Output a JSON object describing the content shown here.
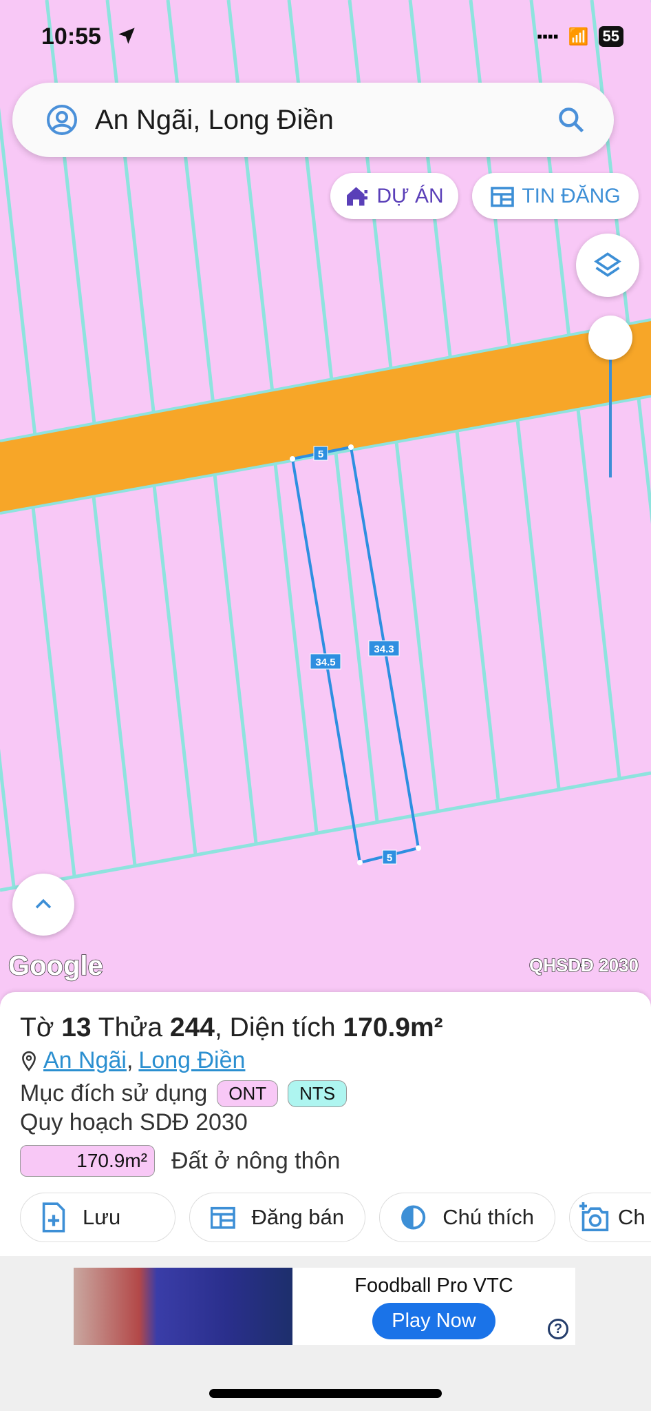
{
  "status_bar": {
    "time": "10:55",
    "battery": "55"
  },
  "search": {
    "value": "An Ngãi, Long Điền"
  },
  "chips": {
    "du_an": "DỰ ÁN",
    "tin_dang": "TIN ĐĂNG"
  },
  "map": {
    "parcel_edges": {
      "top": "5",
      "left": "34.5",
      "right": "34.3",
      "bottom": "5"
    },
    "google_logo": "Google",
    "layer_label": "QHSDĐ 2030",
    "colors": {
      "land": "#f8c8f6",
      "road": "#f7a628",
      "boundary": "#8ee3de",
      "parcel": "#2e8fe0"
    }
  },
  "sheet": {
    "title_prefix": "Tờ ",
    "sheet_no": "13",
    "title_mid": " Thửa ",
    "parcel_no": "244",
    "title_area_label": ", Diện tích ",
    "area": "170.9m²",
    "location": {
      "commune": "An Ngãi",
      "sep": ",",
      "district": "Long Điền"
    },
    "purpose_label": "Mục đích sử dụng",
    "tags": [
      {
        "code": "ONT",
        "color": "#f8c8f6"
      },
      {
        "code": "NTS",
        "color": "#aef5f0"
      }
    ],
    "plan_label": "Quy hoạch SDĐ 2030",
    "plan_area": "170.9m²",
    "plan_type": "Đất ở nông thôn",
    "actions": [
      "Lưu",
      "Đăng bán",
      "Chú thích",
      "Ch"
    ]
  },
  "ad": {
    "title": "Foodball Pro VTC",
    "cta": "Play Now",
    "help": "?"
  }
}
